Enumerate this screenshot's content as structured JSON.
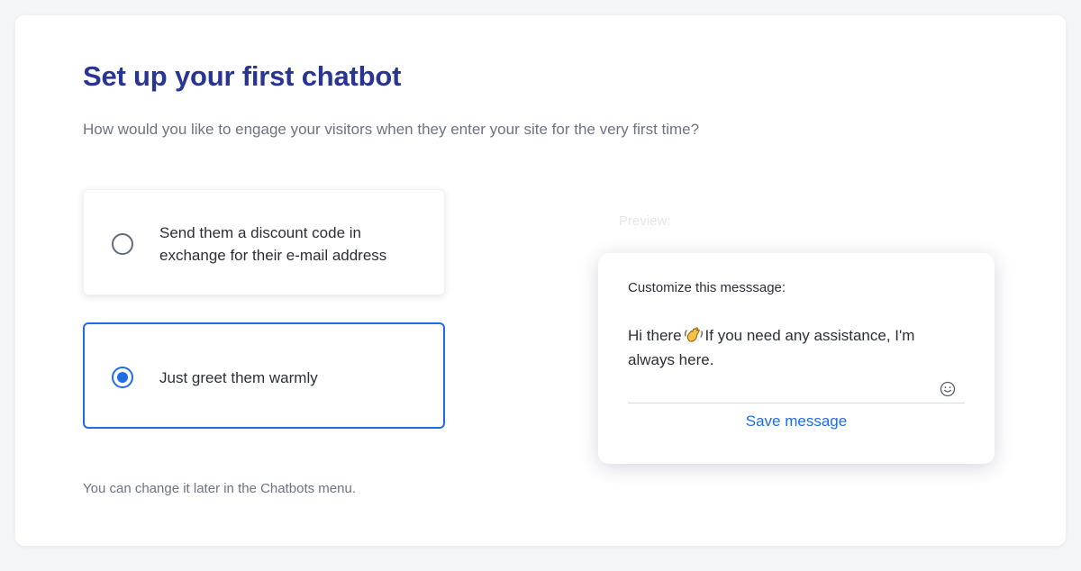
{
  "header": {
    "title": "Set up your first chatbot",
    "subtitle": "How would you like to engage your visitors when they enter your site for the very first time?"
  },
  "options": [
    {
      "label": "Send them a discount code in exchange for their e-mail address",
      "selected": false
    },
    {
      "label": "Just greet them warmly",
      "selected": true
    }
  ],
  "footnote": "You can change it later in the Chatbots menu.",
  "preview": {
    "label": "Preview:",
    "customize_label": "Customize this messsage:",
    "message_before_emoji": "Hi there",
    "emoji": "waving-hand-icon",
    "message_after_emoji": "If you need any assistance, I'm always here.",
    "emoji_button_icon": "smiley-icon",
    "save_label": "Save message"
  },
  "colors": {
    "title": "#283593",
    "accent": "#1e6de4",
    "muted_text": "#6b7385",
    "body_text": "#2c2f3a",
    "background": "#f4f5f8"
  }
}
